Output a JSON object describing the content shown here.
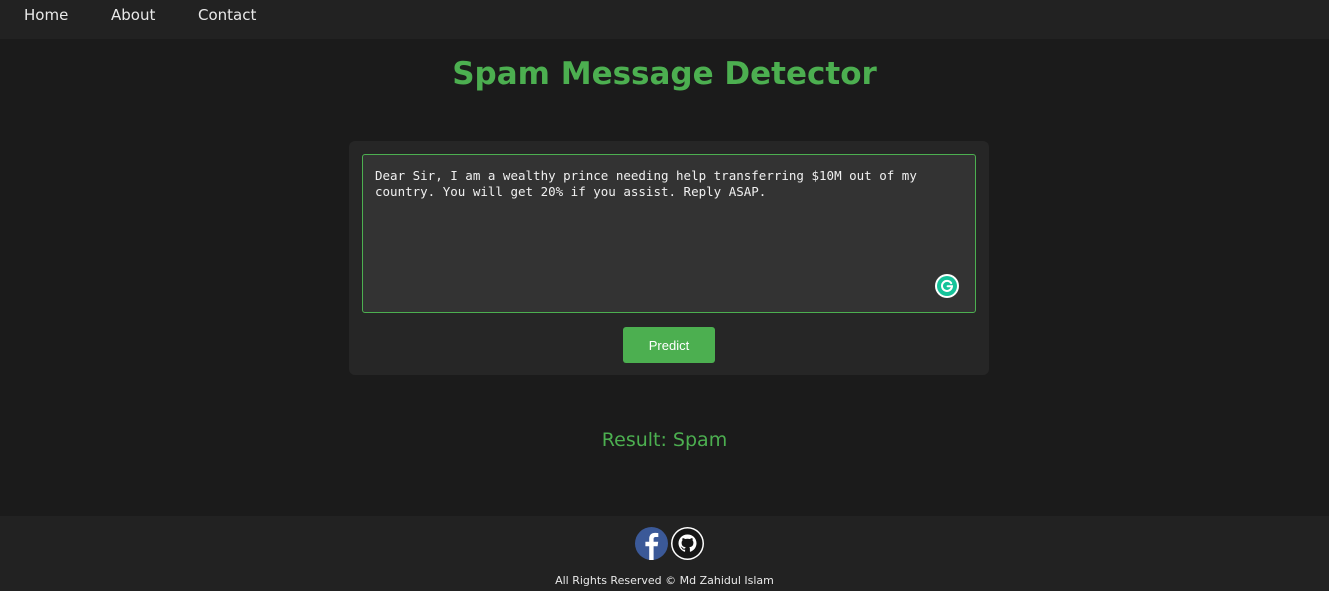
{
  "nav": {
    "home": "Home",
    "about": "About",
    "contact": "Contact"
  },
  "main": {
    "title": "Spam Message Detector",
    "message_value": "Dear Sir, I am a wealthy prince needing help transferring $10M out of my country. You will get 20% if you assist. Reply ASAP.",
    "predict_label": "Predict",
    "result": "Result: Spam"
  },
  "footer": {
    "copyright": "All Rights Reserved © Md Zahidul Islam",
    "icons": [
      "facebook-icon",
      "github-icon"
    ]
  },
  "colors": {
    "accent": "#4caf50",
    "background": "#1b1b1b",
    "navbar": "#222222",
    "card": "#262626",
    "input": "#333333",
    "facebook": "#3b5998"
  }
}
